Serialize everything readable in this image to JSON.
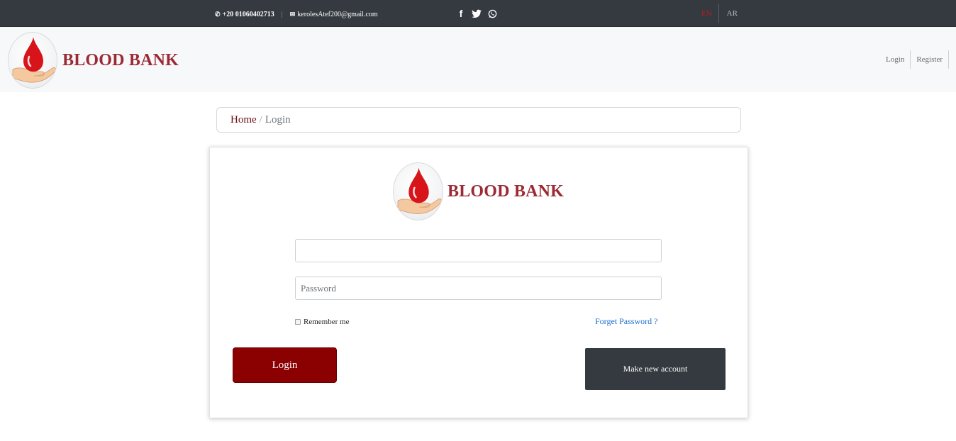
{
  "topbar": {
    "phone": "+20 01060402713",
    "email": "kerolesAtef200@gmail.com",
    "social": [
      "facebook-icon",
      "twitter-icon",
      "whatsapp-icon"
    ],
    "languages": {
      "en": "EN",
      "ar": "AR"
    },
    "active_language_color": "#c21a1a"
  },
  "navbar": {
    "brand": "BLOOD BANK",
    "links": {
      "login": "Login",
      "register": "Register"
    }
  },
  "breadcrumb": {
    "home": "Home",
    "separator": "/",
    "current": "Login"
  },
  "login_form": {
    "brand": "BLOOD BANK",
    "username_value": "",
    "username_placeholder": "",
    "password_placeholder": "Password",
    "remember_label": "Remember me",
    "forgot_link": "Forget Password ?",
    "login_button": "Login",
    "new_account_button": "Make new account"
  },
  "colors": {
    "brand_red": "#9b2a34",
    "login_button": "#8b0000",
    "dark": "#343a40",
    "link_blue": "#1b6fd1"
  }
}
